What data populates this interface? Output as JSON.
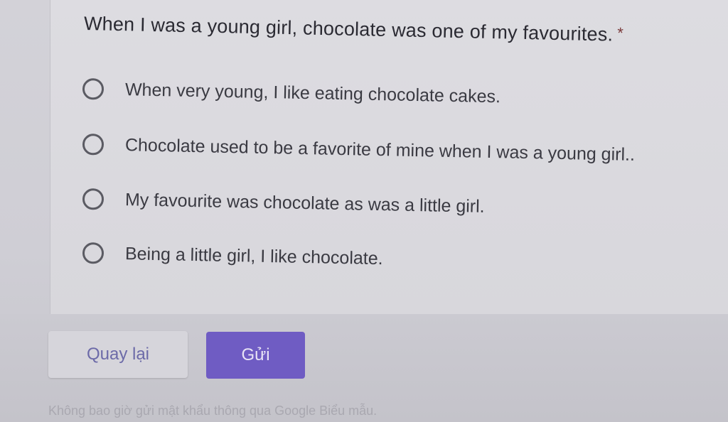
{
  "question": {
    "title": "When I was a young girl, chocolate was one of my favourites.",
    "required_mark": "*",
    "options": [
      {
        "label": "When very young, I like eating chocolate cakes."
      },
      {
        "label": "Chocolate used to be a favorite of mine when I was a young girl.."
      },
      {
        "label": "My favourite was chocolate as was a little girl."
      },
      {
        "label": "Being a little girl, I like chocolate."
      }
    ]
  },
  "navigation": {
    "back_label": "Quay lại",
    "submit_label": "Gửi"
  },
  "footer": {
    "note": "Không bao giờ gửi mật khẩu thông qua Google Biểu mẫu."
  },
  "colors": {
    "accent": "#6f5cc3",
    "back_text": "#6c6aa8"
  }
}
